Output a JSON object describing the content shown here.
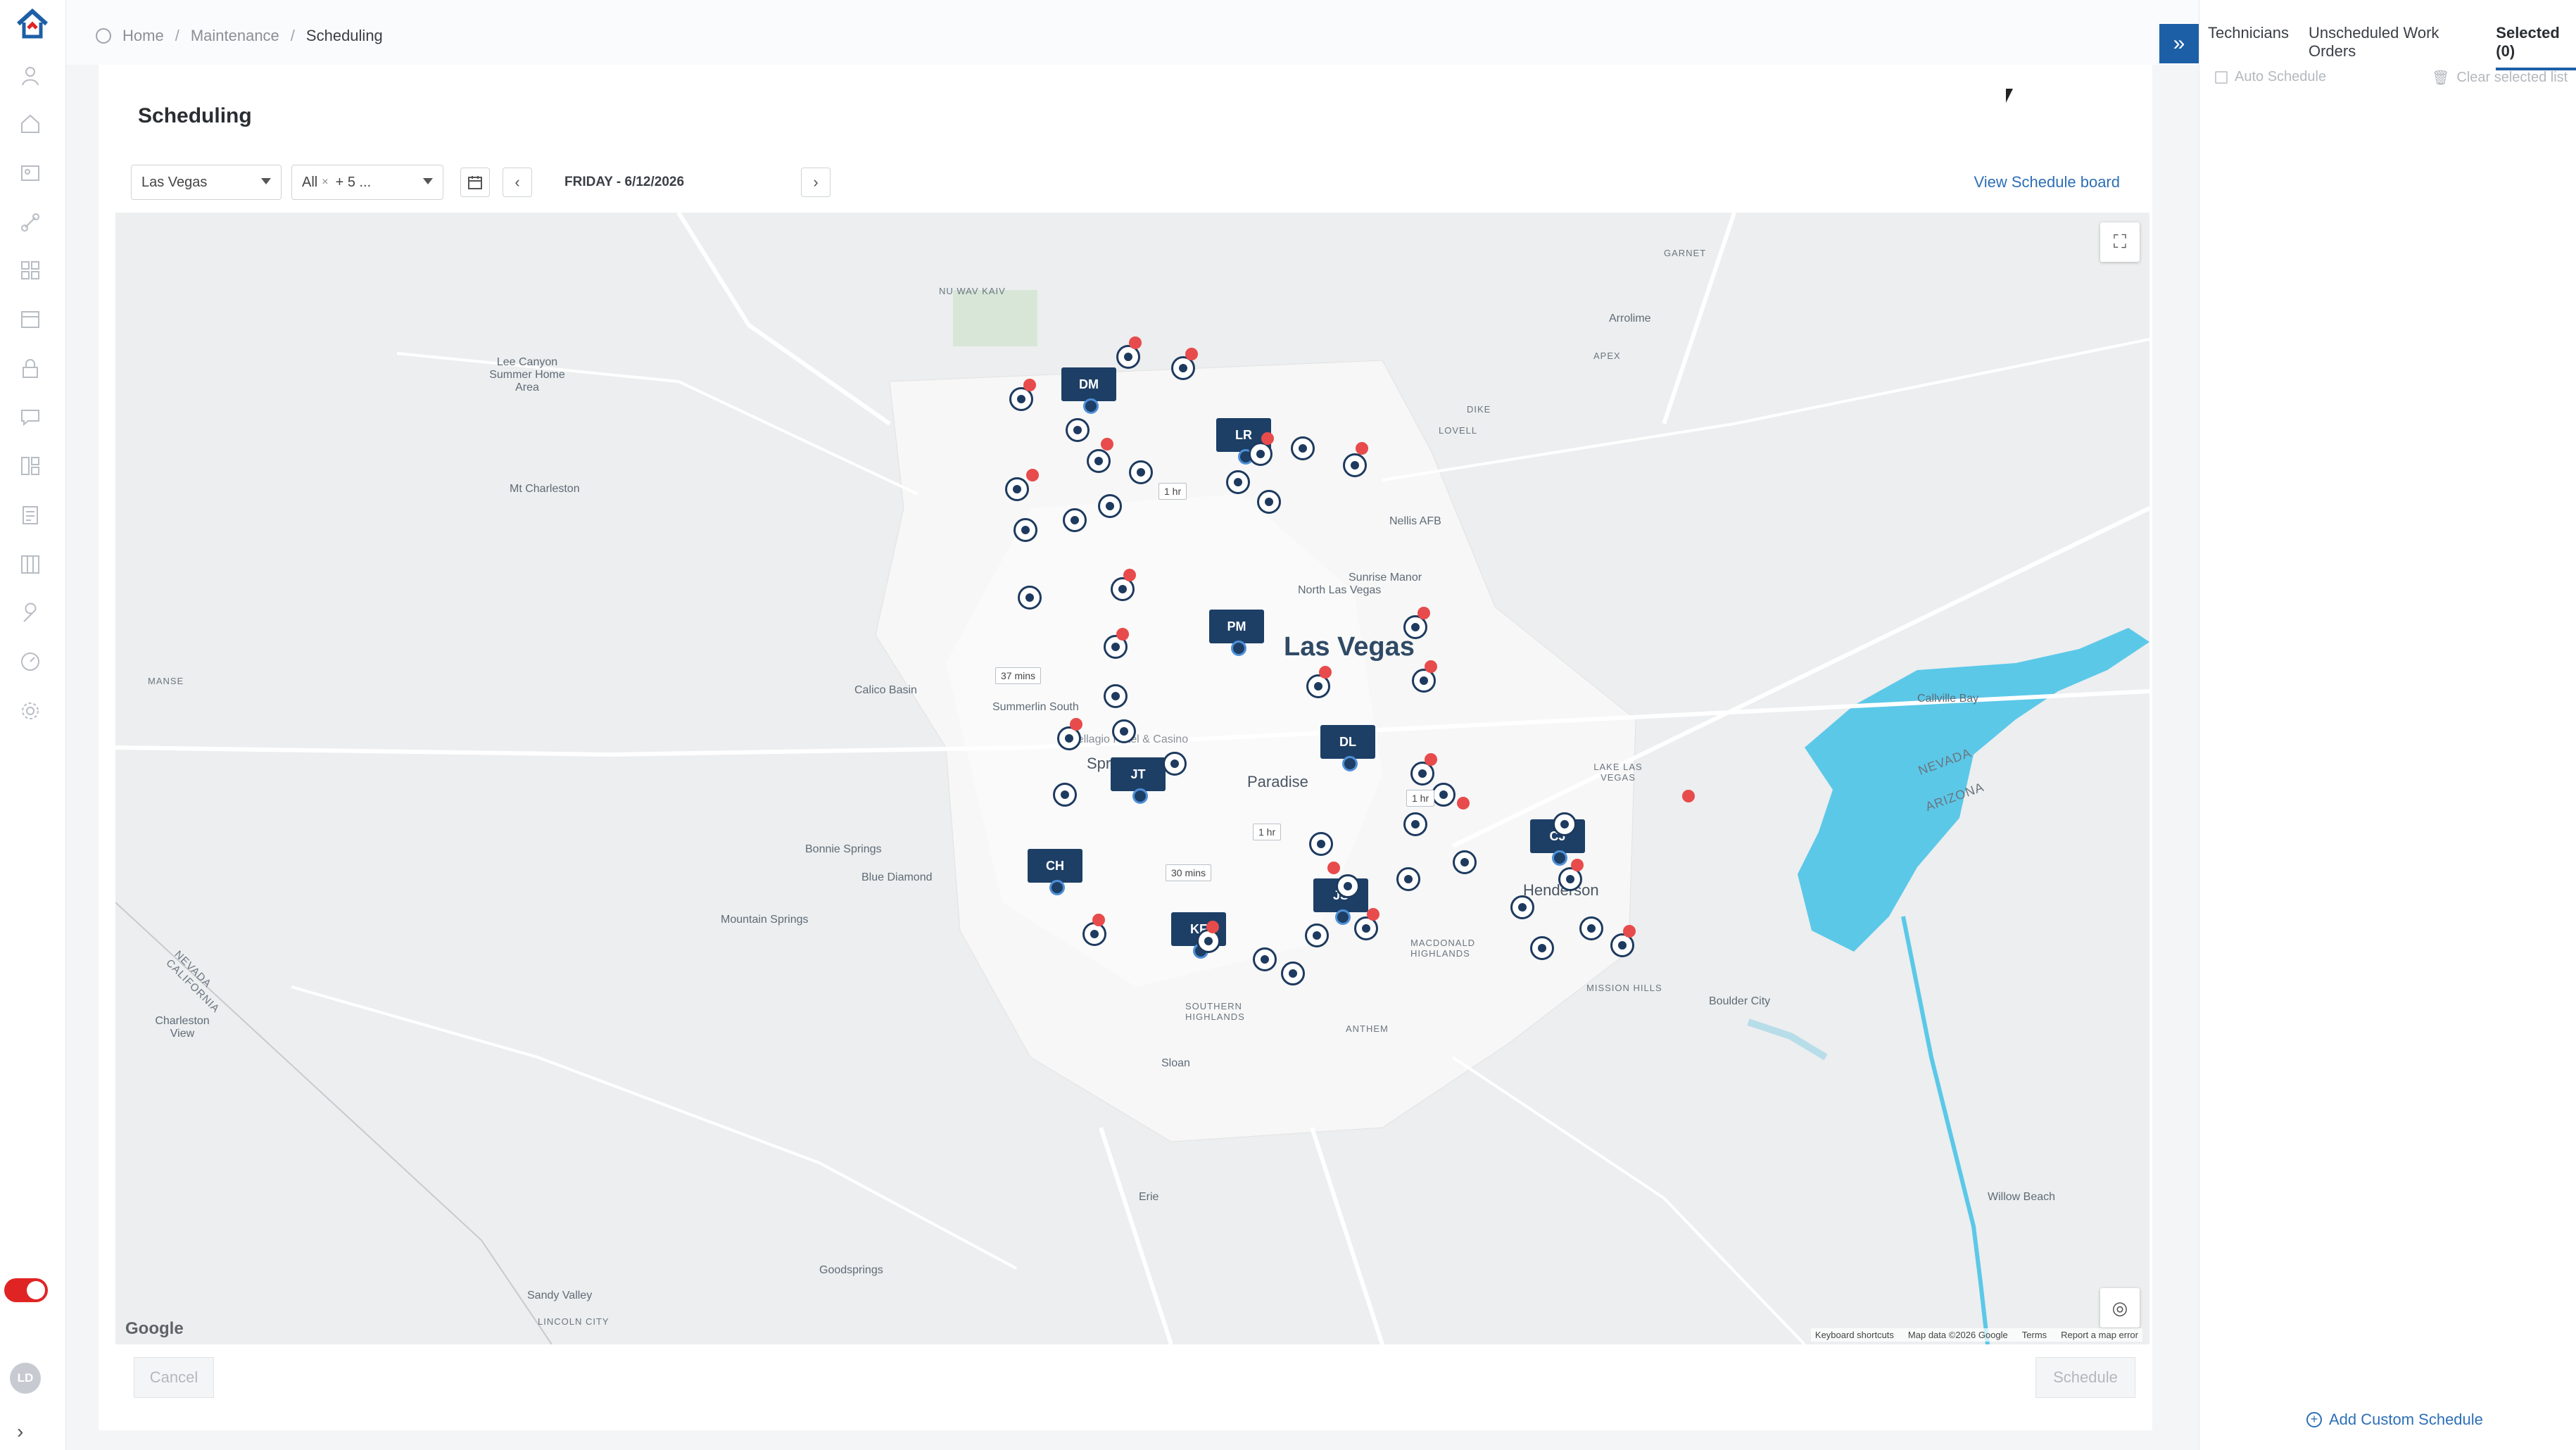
{
  "breadcrumb": {
    "home": "Home",
    "section": "Maintenance",
    "current": "Scheduling"
  },
  "page": {
    "title": "Scheduling"
  },
  "filters": {
    "location": "Las Vegas",
    "category_chip": "All",
    "category_more": "+ 5 ...",
    "date": "FRIDAY - 6/12/2026",
    "view_board": "View Schedule board"
  },
  "map": {
    "labels": {
      "las_vegas": "Las Vegas",
      "paradise": "Paradise",
      "henderson": "Henderson",
      "north_lv": "North Las Vegas",
      "nellis": "Nellis AFB",
      "sunrise": "Sunrise Manor",
      "summerlin": "Summerlin South",
      "spring_valley": "Spring Valley",
      "calico": "Calico Basin",
      "blue_diamond": "Blue Diamond",
      "bonnie": "Bonnie Springs",
      "mountain_springs": "Mountain Springs",
      "mt_charleston": "Mt Charleston",
      "lee_canyon": "Lee Canyon Summer Home Area",
      "sloan": "Sloan",
      "erie": "Erie",
      "boulder_city": "Boulder City",
      "callville": "Callville Bay",
      "willow_beach": "Willow Beach",
      "sandy_valley": "Sandy Valley",
      "goodsprings": "Goodsprings",
      "charleston_view": "Charleston View",
      "arrolime": "Arrolime",
      "apex": "APEX",
      "garnet": "GARNET",
      "dike": "DIKE",
      "lovell": "LOVELL",
      "manse": "MANSE",
      "nu_wav_kaiv": "NU WAV KAIV",
      "lincoln_city": "LINCOLN CITY",
      "anthem": "ANTHEM",
      "mission_hills": "MISSION HILLS",
      "macdonald": "MACDONALD HIGHLANDS",
      "southern_highlands": "SOUTHERN HIGHLANDS",
      "lake_las_vegas": "LAKE LAS VEGAS",
      "state_nevada": "NEVADA",
      "state_arizona": "ARIZONA",
      "state_california": "NEVADA CALIFORNIA",
      "hotel": "Bellagio Hotel & Casino"
    },
    "technicians": [
      "DM",
      "LR",
      "PM",
      "DL",
      "JT",
      "CJ",
      "CH",
      "JS",
      "KF"
    ],
    "durations": {
      "a": "1 hr",
      "b": "37 mins",
      "c": "1 hr",
      "d": "1 hr",
      "e": "30 mins"
    },
    "google": "Google",
    "footer": {
      "shortcuts": "Keyboard shortcuts",
      "mapdata": "Map data ©2026 Google",
      "terms": "Terms",
      "report": "Report a map error"
    },
    "water_color": "#5bc8e8"
  },
  "actions": {
    "cancel": "Cancel",
    "schedule": "Schedule"
  },
  "panel": {
    "tabs": [
      "Technicians",
      "Unscheduled Work Orders",
      "Selected (0)"
    ],
    "auto_schedule": "Auto Schedule",
    "clear_list": "Clear selected list",
    "add_custom": "Add Custom Schedule"
  },
  "user": {
    "initials": "LD"
  },
  "colors": {
    "accent": "#1d5fa6",
    "tech_pin": "#1d3f66",
    "badge": "#e84b4b",
    "toggle": "#e02424"
  }
}
